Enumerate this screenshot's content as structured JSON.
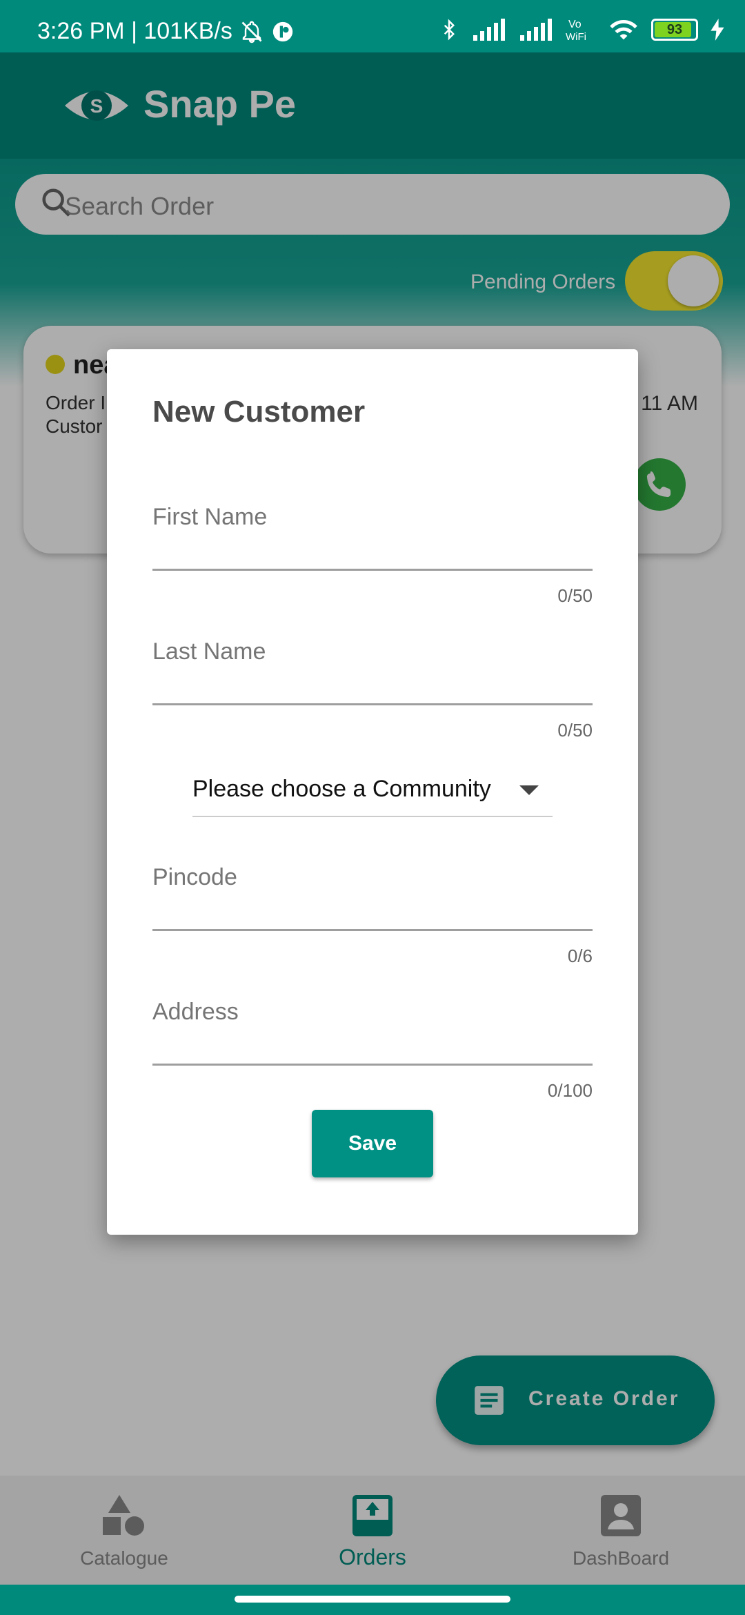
{
  "status_bar": {
    "time_speed": "3:26 PM | 101KB/s",
    "battery": "93"
  },
  "app": {
    "title": "Snap Pe",
    "logo_letter": "S"
  },
  "search": {
    "placeholder": "Search Order"
  },
  "pending": {
    "label": "Pending Orders",
    "enabled": true
  },
  "order_card": {
    "name": "nea",
    "line1": "Order I",
    "line2": "Custor",
    "time": "11 AM"
  },
  "dialog": {
    "title": "New Customer",
    "fields": [
      {
        "label": "First Name",
        "counter": "0/50"
      },
      {
        "label": "Last Name",
        "counter": "0/50"
      },
      {
        "label": "Pincode",
        "counter": "0/6"
      },
      {
        "label": "Address",
        "counter": "0/100"
      }
    ],
    "community_dropdown": "Please choose a Community",
    "save_label": "Save"
  },
  "fab": {
    "label": "Create Order"
  },
  "bottom_nav": {
    "items": [
      {
        "label": "Catalogue",
        "icon": "shapes-icon"
      },
      {
        "label": "Orders",
        "icon": "inbox-upload-icon",
        "active": true
      },
      {
        "label": "DashBoard",
        "icon": "account-box-icon"
      }
    ]
  },
  "colors": {
    "primary": "#008a7c",
    "accent_toggle": "#f3e630"
  }
}
